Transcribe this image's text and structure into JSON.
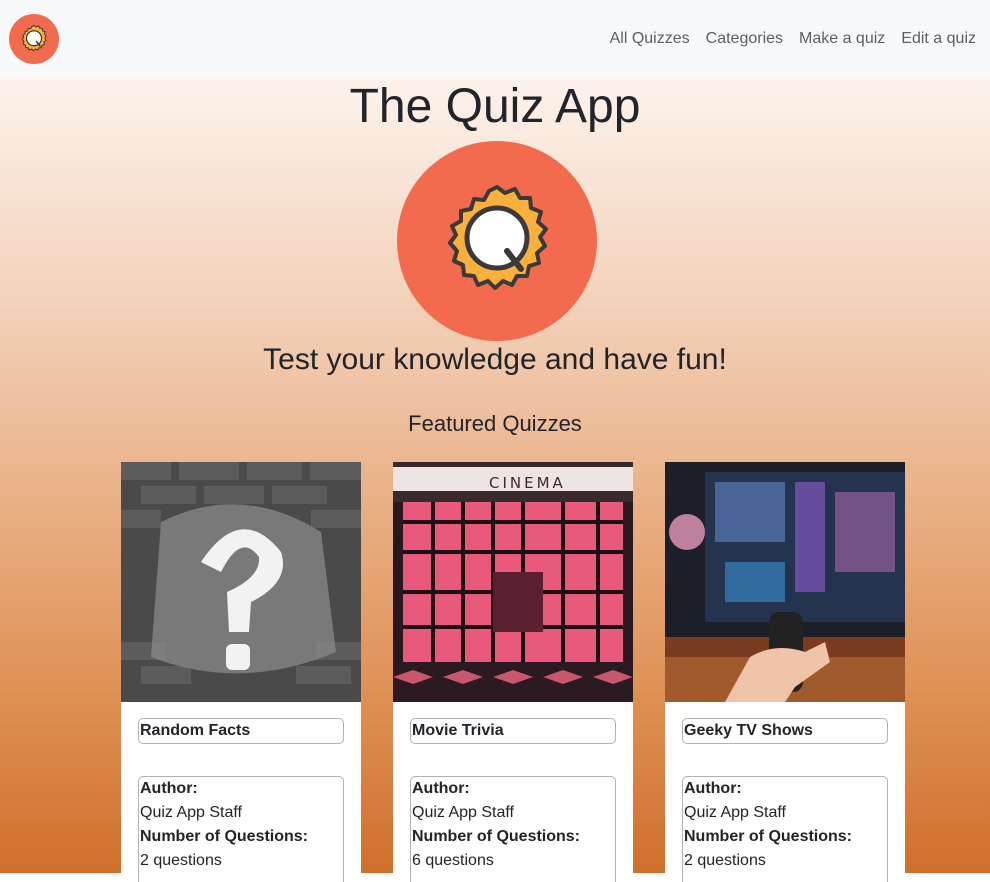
{
  "nav": {
    "brand_icon": "quiz-logo-icon",
    "links": [
      "All Quizzes",
      "Categories",
      "Make a quiz",
      "Edit a quiz"
    ]
  },
  "hero": {
    "title": "The Quiz App",
    "logo_icon": "quiz-logo-icon",
    "tagline": "Test your knowledge and have fun!"
  },
  "featured": {
    "heading": "Featured Quizzes",
    "author_label": "Author:",
    "questions_label": "Number of Questions:",
    "cards": [
      {
        "title": "Random Facts",
        "author": "Quiz App Staff",
        "questions": "2 questions",
        "image": "question-mark-wall-image"
      },
      {
        "title": "Movie Trivia",
        "author": "Quiz App Staff",
        "questions": "6 questions",
        "image": "cinema-storefront-image"
      },
      {
        "title": "Geeky TV Shows",
        "author": "Quiz App Staff",
        "questions": "2 questions",
        "image": "tv-remote-image"
      }
    ]
  },
  "colors": {
    "accent": "#f26b4e",
    "badge": "#fbb03b",
    "navbar_bg": "#f8f9fa",
    "gradient_bottom": "#d06f2c"
  }
}
